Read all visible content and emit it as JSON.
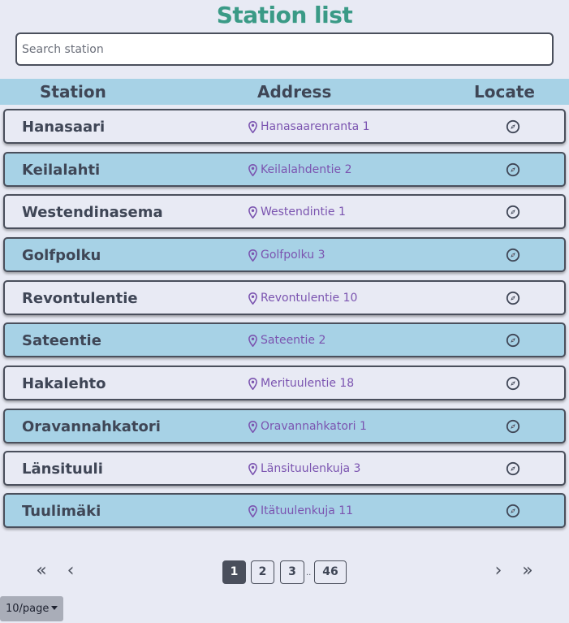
{
  "page": {
    "title": "Station list"
  },
  "search": {
    "placeholder": "Search station",
    "value": ""
  },
  "table": {
    "headers": {
      "station": "Station",
      "address": "Address",
      "locate": "Locate"
    },
    "rows": [
      {
        "name": "Hanasaari",
        "address": "Hanasaarenranta 1",
        "locate_icon": "compass-icon"
      },
      {
        "name": "Keilalahti",
        "address": "Keilalahdentie 2",
        "locate_icon": "compass-icon"
      },
      {
        "name": "Westendinasema",
        "address": "Westendintie 1",
        "locate_icon": "compass-icon"
      },
      {
        "name": "Golfpolku",
        "address": "Golfpolku 3",
        "locate_icon": "compass-icon"
      },
      {
        "name": "Revontulentie",
        "address": "Revontulentie 10",
        "locate_icon": "compass-icon"
      },
      {
        "name": "Sateentie",
        "address": "Sateentie 2",
        "locate_icon": "compass-icon"
      },
      {
        "name": "Hakalehto",
        "address": "Merituulentie 18",
        "locate_icon": "compass-icon"
      },
      {
        "name": "Oravannahkatori",
        "address": "Oravannahkatori 1",
        "locate_icon": "compass-icon"
      },
      {
        "name": "Länsituuli",
        "address": "Länsituulenkuja 3",
        "locate_icon": "compass-icon"
      },
      {
        "name": "Tuulimäki",
        "address": "Itätuulenkuja 11",
        "locate_icon": "compass-icon"
      }
    ]
  },
  "pagination": {
    "first": "«",
    "prev": "‹",
    "next": "›",
    "last": "»",
    "pages": [
      "1",
      "2",
      "3",
      "46"
    ],
    "ellipsis": "..",
    "current": "1"
  },
  "per_page": {
    "label": "10/page"
  },
  "colors": {
    "title": "#3a9a86",
    "row_alt": "#a7d2e6",
    "row_base": "#e8eaf4",
    "address": "#7b54b0",
    "active_page": "#4a4f5c"
  }
}
